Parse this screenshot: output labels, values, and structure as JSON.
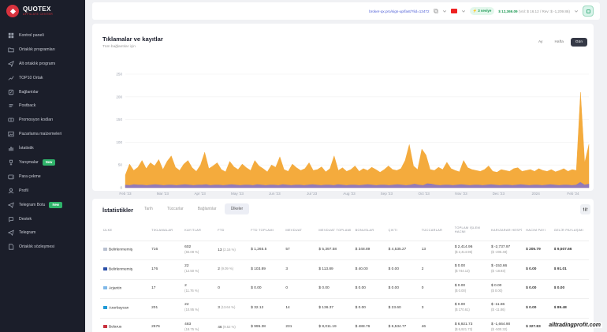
{
  "brand": {
    "title": "QUOTEX",
    "subtitle": "AFFILIATE CENTER"
  },
  "sidebar": {
    "items": [
      {
        "label": "Kontrol paneli",
        "icon": "dashboard-icon"
      },
      {
        "label": "Ortaklık programları",
        "icon": "folder-icon"
      },
      {
        "label": "Alt ortaklık programı",
        "icon": "send-icon"
      },
      {
        "label": "TOP10 Ortak",
        "icon": "trend-icon"
      },
      {
        "label": "Bağlantılar",
        "icon": "link-icon"
      },
      {
        "label": "Postback",
        "icon": "postback-icon"
      },
      {
        "label": "Promosyon kodları",
        "icon": "promo-icon"
      },
      {
        "label": "Pazarlama malzemeleri",
        "icon": "image-icon"
      },
      {
        "label": "İstatistik",
        "icon": "stats-icon"
      },
      {
        "label": "Yarışmalar",
        "icon": "trophy-icon",
        "badge": "New"
      },
      {
        "label": "Para çekme",
        "icon": "wallet-icon"
      },
      {
        "label": "Profil",
        "icon": "user-icon"
      },
      {
        "label": "Telegram Botu",
        "icon": "bot-icon",
        "badge": "New"
      },
      {
        "label": "Destek",
        "icon": "support-icon"
      },
      {
        "label": "Telegram",
        "icon": "telegram-icon"
      },
      {
        "label": "Ortaklık sözleşmesi",
        "icon": "document-icon"
      }
    ]
  },
  "topbar": {
    "url": "broker-qx.pro/sign-up/fast/?lid=13472",
    "level": "3 seviye",
    "balance": "$ 12,369.09",
    "balance_detail": "(Vol: $ 16.12 / Rev: $ -1,209.86)"
  },
  "chart": {
    "title": "Tıklamalar ve kayıtlar",
    "subtitle": "Tüm bağlantılar için",
    "ranges": [
      "Ay",
      "Hafta",
      "Gün"
    ],
    "active_range": "Gün"
  },
  "chart_data": {
    "type": "area",
    "ylim": [
      0,
      250
    ],
    "y_ticks": [
      0,
      50,
      100,
      150,
      200,
      250
    ],
    "y_tick_labels": [
      "0",
      "50",
      "100",
      "150",
      "200",
      "250"
    ],
    "x_tick_labels": [
      "Feb '23",
      "Mar '23",
      "Apr '23",
      "May '23",
      "Jun '23",
      "Jul '23",
      "Aug '23",
      "Sep '23",
      "Oct '23",
      "Nov '23",
      "Dec '23",
      "2024",
      "Feb '24"
    ],
    "series": [
      {
        "color": "#f3a633",
        "values": [
          28,
          52,
          38,
          45,
          60,
          42,
          55,
          48,
          62,
          40,
          58,
          70,
          45,
          38,
          52,
          60,
          44,
          36,
          50,
          78,
          42,
          48,
          55,
          40,
          35,
          58,
          46,
          40,
          52,
          44,
          38,
          60,
          48,
          42,
          35,
          50,
          45,
          68,
          40,
          36,
          52,
          44,
          38,
          42,
          55,
          38,
          40,
          46,
          35,
          42,
          70,
          38,
          44,
          36,
          40,
          48,
          36,
          42,
          38,
          45,
          40,
          34,
          40,
          48,
          40,
          38,
          42,
          60,
          95,
          48,
          40,
          85,
          72,
          40,
          38,
          45,
          40,
          56,
          42,
          38,
          35,
          60,
          44,
          40,
          38,
          36,
          40,
          48,
          36,
          34,
          40,
          38,
          36,
          42,
          44,
          36,
          38,
          40,
          36,
          42,
          38,
          36,
          40,
          35,
          38,
          42,
          36,
          40,
          38,
          210,
          55,
          95
        ]
      },
      {
        "color": "#7b6fd6",
        "values": [
          6,
          5,
          7,
          6,
          6,
          5,
          6,
          7,
          6,
          5,
          6,
          6,
          5,
          6,
          7,
          6,
          5,
          6,
          6,
          7,
          5,
          6,
          6,
          5,
          6,
          7,
          6,
          5,
          6,
          6,
          5,
          7,
          6,
          5,
          6,
          6,
          5,
          7,
          6,
          5,
          6,
          6,
          5,
          6,
          7,
          6,
          5,
          6,
          6,
          5,
          7,
          6,
          5,
          6,
          6,
          5,
          6,
          7,
          6,
          5,
          6,
          6,
          5,
          6,
          7,
          6,
          5,
          6,
          8,
          6,
          5,
          9,
          8,
          6,
          5,
          6,
          6,
          5,
          6,
          7,
          6,
          5,
          6,
          6,
          5,
          6,
          7,
          6,
          5,
          6,
          6,
          5,
          6,
          7,
          6,
          5,
          6,
          6,
          5,
          6,
          7,
          6,
          5,
          6,
          6,
          5,
          6,
          12,
          6,
          8
        ]
      }
    ]
  },
  "stats": {
    "title": "İstatistikler",
    "tabs": [
      "Tarih",
      "Tüccarlar",
      "Bağlantılar",
      "Ülkeler"
    ],
    "active_tab": "Ülkeler",
    "columns": [
      "ÜLKE",
      "TIKLAMALAR",
      "KAYITLAR",
      "FTD",
      "FTD TOPLAMI",
      "MEVDUAT",
      "MEVDUAT TOPLAMI",
      "BONUSLAR",
      "ÇIKTI",
      "TÜCCARLAR",
      "TOPLAM İŞLEM HACMI",
      "KAR/ZARAR HESPİ",
      "HACIM PAYI",
      "GELİR PAYLAŞIMI"
    ],
    "rows": [
      {
        "country": "Belirlenmemiş",
        "flag": "#b8c0d0",
        "clicks": "716",
        "regs": "602",
        "regs_pct": "(84.08 %)",
        "ftd": "13",
        "ftd_pct": "(2.16 %)",
        "ftd_total": "$ 1,265.5",
        "deposits": "57",
        "deposit_total": "$ 5,397.58",
        "bonuses": "$ 348.89",
        "output": "$ 4,535.27",
        "traders": "13",
        "volume": "$ 2,414.96",
        "volume_sub": "($ 2,414.96)",
        "pnl": "$ -2,737.97",
        "pnl_sub": "($ -205.48)",
        "vol_share": "$ 205.79",
        "rev_share": "$ 9,507.66"
      },
      {
        "country": "Belirlenmemiş",
        "flag": "#2b4fa8",
        "clicks": "176",
        "regs": "22",
        "regs_pct": "(12.50 %)",
        "ftd": "2",
        "ftd_pct": "(9.09 %)",
        "ftd_total": "$ 103.89",
        "deposits": "3",
        "deposit_total": "$ 113.89",
        "bonuses": "$ 40.00",
        "output": "$ 0.00",
        "traders": "2",
        "volume": "$ 0.00",
        "volume_sub": "($ 744.13)",
        "pnl": "$ -153.66",
        "pnl_sub": "($ -18.93)",
        "vol_share": "$ 0.00",
        "rev_share": "$ 91.01"
      },
      {
        "country": "Arjantin",
        "flag": "#7fb8e8",
        "clicks": "17",
        "regs": "2",
        "regs_pct": "(11.76 %)",
        "ftd": "0",
        "ftd_pct": "",
        "ftd_total": "$ 0.00",
        "deposits": "0",
        "deposit_total": "$ 0.00",
        "bonuses": "$ 0.00",
        "output": "$ 0.00",
        "traders": "0",
        "volume": "$ 0.00",
        "volume_sub": "($ 0.00)",
        "pnl": "$ 0.00",
        "pnl_sub": "($ 0.00)",
        "vol_share": "$ 0.00",
        "rev_share": "$ 0.00"
      },
      {
        "country": "Azerbaycan",
        "flag": "#1f9ad6",
        "clicks": "201",
        "regs": "22",
        "regs_pct": "(10.95 %)",
        "ftd": "3",
        "ftd_pct": "(13.64 %)",
        "ftd_total": "$ 32.12",
        "deposits": "14",
        "deposit_total": "$ 136.37",
        "bonuses": "$ 0.00",
        "output": "$ 23.60",
        "traders": "3",
        "volume": "$ 0.00",
        "volume_sub": "($ 170.61)",
        "pnl": "$ -11.86",
        "pnl_sub": "($ -11.86)",
        "vol_share": "$ 0.00",
        "rev_share": "$ 89.48"
      },
      {
        "country": "Belarus",
        "flag": "#c8313e",
        "clicks": "2576",
        "regs": "483",
        "regs_pct": "(18.75 %)",
        "ftd": "46",
        "ftd_pct": "(9.52 %)",
        "ftd_total": "$ 995.38",
        "deposits": "231",
        "deposit_total": "$ 8,011.19",
        "bonuses": "$ 488.76",
        "output": "$ 6,534.77",
        "traders": "46",
        "volume": "$ 6,921.73",
        "volume_sub": "($ 6,921.73)",
        "pnl": "$ -1,664.90",
        "pnl_sub": "($ -500.32)",
        "vol_share": "$ 327.83",
        "rev_share": "$ 4,573.27"
      }
    ]
  },
  "watermark": "alltradingprofit.com"
}
